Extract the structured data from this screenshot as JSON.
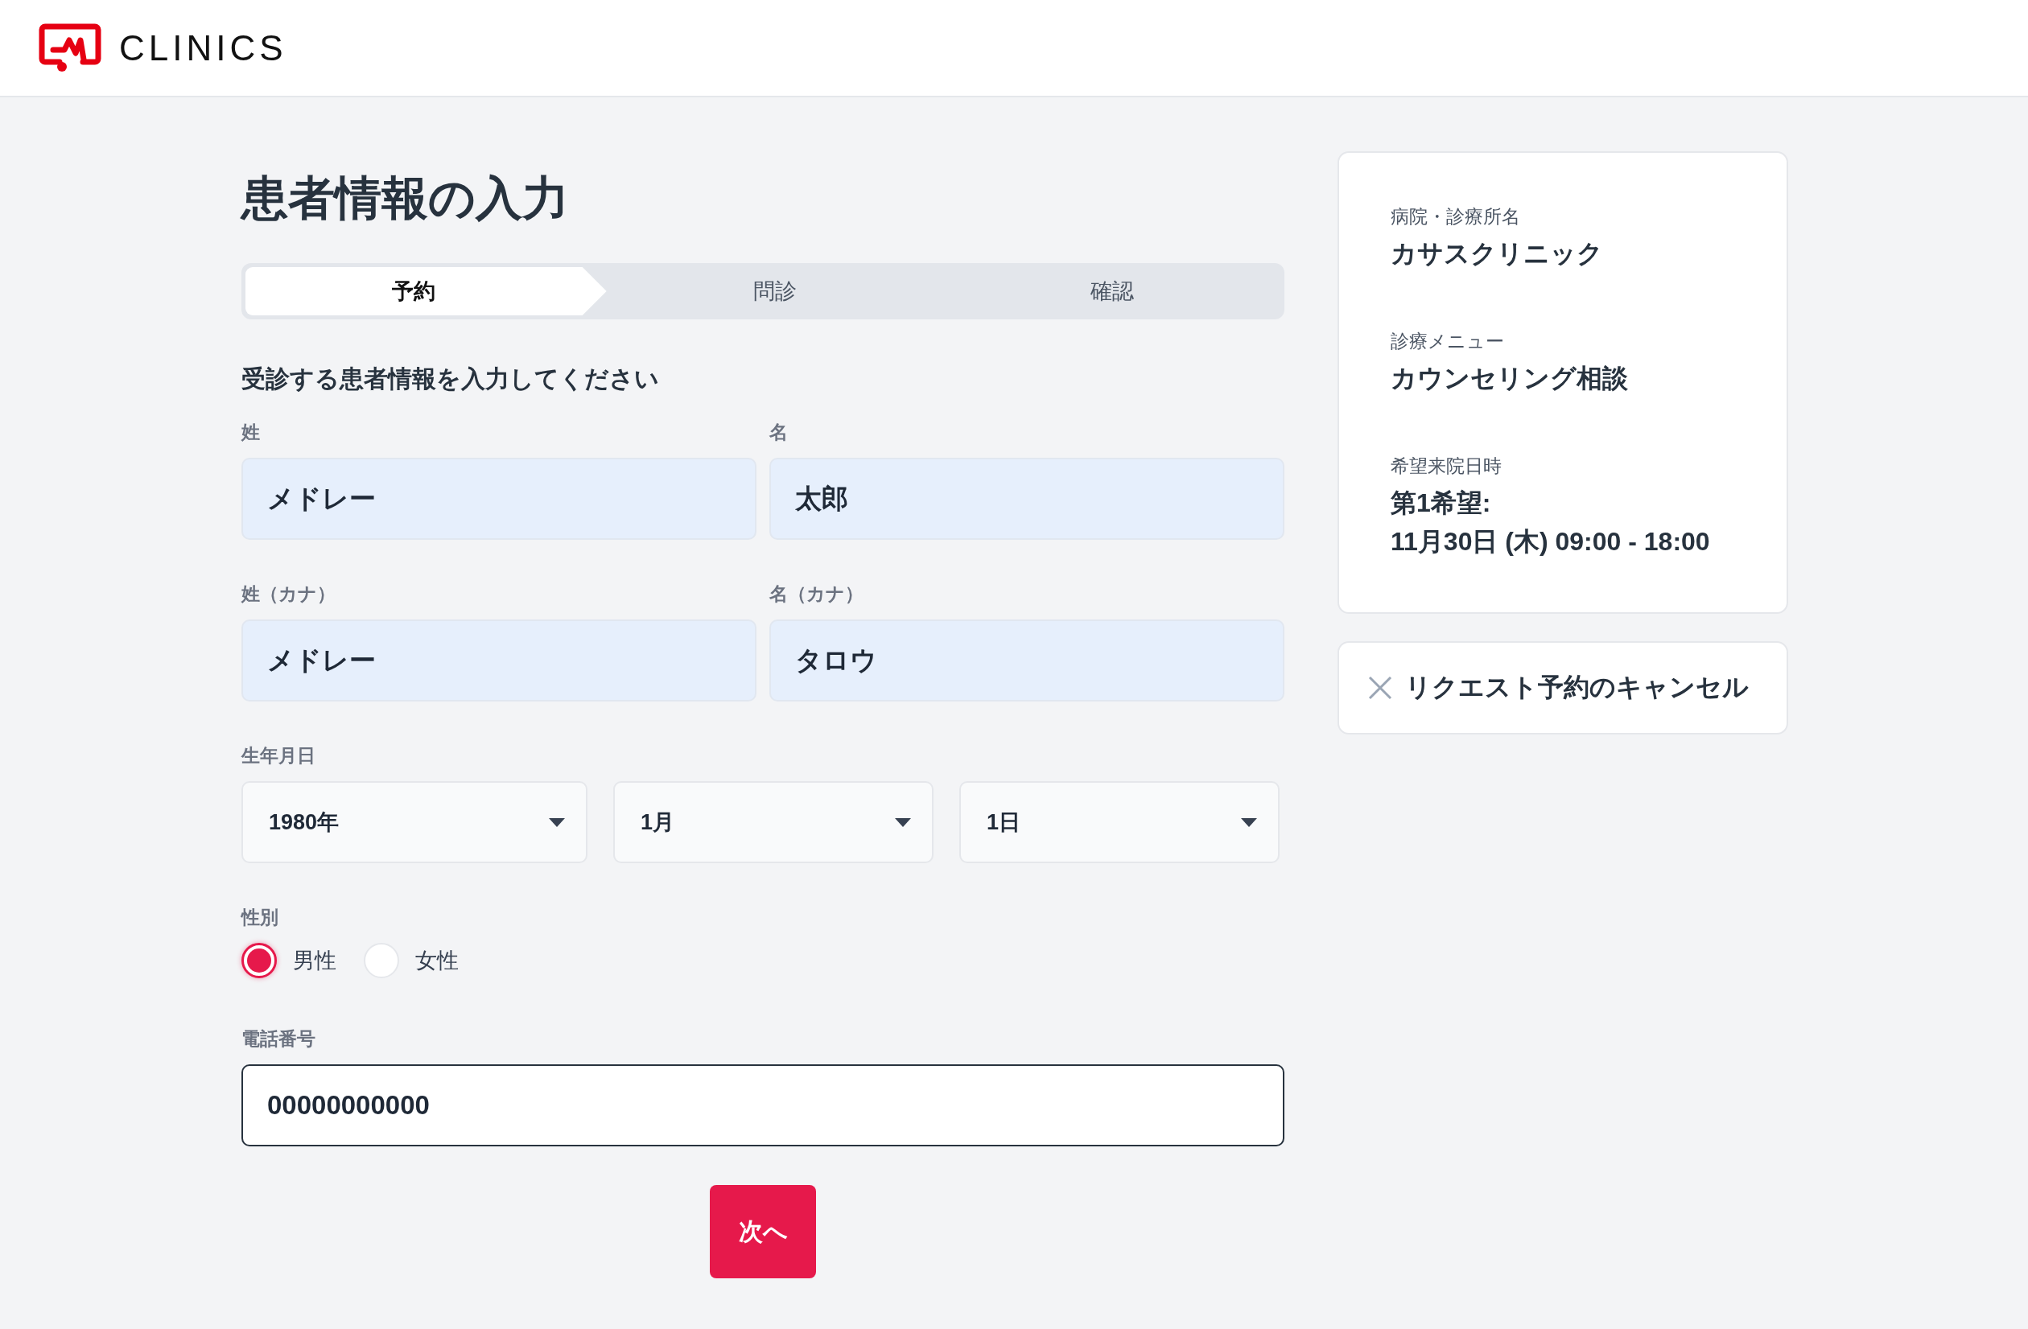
{
  "header": {
    "logo_text": "CLINICS"
  },
  "form": {
    "title": "患者情報の入力",
    "steps": [
      {
        "label": "予約",
        "selected": true
      },
      {
        "label": "問診",
        "selected": false
      },
      {
        "label": "確認",
        "selected": false
      }
    ],
    "heading": "受診する患者情報を入力してください",
    "name_fields": [
      {
        "label": "姓",
        "value": "メドレー"
      },
      {
        "label": "名",
        "value": "太郎"
      }
    ],
    "kana_fields": [
      {
        "label": "姓（カナ）",
        "value": "メドレー"
      },
      {
        "label": "名（カナ）",
        "value": "タロウ"
      }
    ],
    "birthdate": {
      "label": "生年月日",
      "selects": [
        "1980年",
        "1月",
        "1日"
      ]
    },
    "gender": {
      "label": "性別",
      "options": [
        {
          "label": "男性",
          "selected": true
        },
        {
          "label": "女性",
          "selected": false
        }
      ]
    },
    "phone": {
      "label": "電話番号",
      "value": "00000000000"
    },
    "next_button": "次へ"
  },
  "summary": {
    "items": [
      {
        "label": "病院・診療所名",
        "values": [
          "カサスクリニック"
        ]
      },
      {
        "label": "診療メニュー",
        "values": [
          "カウンセリング相談"
        ]
      },
      {
        "label": "希望来院日時",
        "values": [
          "第1希望:",
          "11月30日 (木) 09:00 - 18:00"
        ]
      }
    ],
    "cancel_button": "リクエスト予約のキャンセル"
  }
}
